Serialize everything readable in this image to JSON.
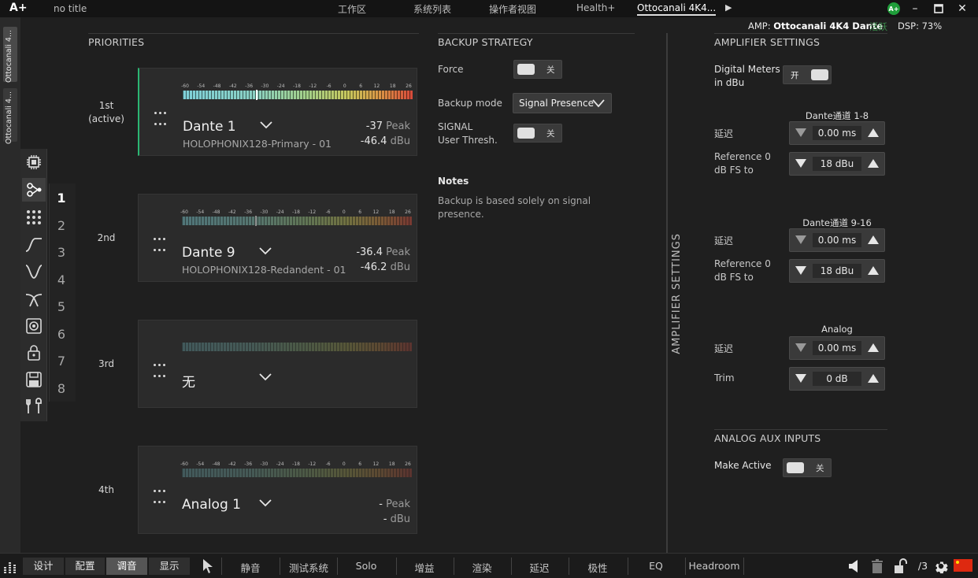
{
  "app": {
    "logo": "A+",
    "doc_title": "no title"
  },
  "top_tabs": [
    {
      "label": "工作区"
    },
    {
      "label": "系统列表"
    },
    {
      "label": "操作者视图"
    },
    {
      "label": "Health+"
    },
    {
      "label": "Ottocanali 4K4...",
      "active": true
    }
  ],
  "user_badge": "A+",
  "status": {
    "amp_prefix": "AMP:",
    "amp_name": "Ottocanali 4K4 Dante",
    "amp_state": "活跃",
    "dsp": "DSP:  73%"
  },
  "side_tabs": [
    "Ottocanali 4...",
    "Ottocanali 4..."
  ],
  "channel_numbers": [
    "1",
    "2",
    "3",
    "4",
    "5",
    "6",
    "7",
    "8"
  ],
  "tool_icons": [
    "processor-icon",
    "routing-icon",
    "matrix-icon",
    "lowpass-icon",
    "highpass-icon",
    "crossover-icon",
    "speaker-icon",
    "lock-icon",
    "save-icon",
    "tools-icon"
  ],
  "priorities": {
    "title": "PRIORITIES",
    "scale": [
      "-60",
      "-54",
      "-48",
      "-42",
      "-36",
      "-30",
      "-24",
      "-18",
      "-12",
      "-6",
      "0",
      "6",
      "12",
      "18",
      "26"
    ],
    "items": [
      {
        "rank": "1st",
        "rank_note": "(active)",
        "name": "Dante 1",
        "source": "HOLOPHONIX128-Primary - 01",
        "peak": "-37",
        "peak_unit": "Peak",
        "dbu": "-46.4",
        "dbu_unit": "dBu",
        "meter_level": 0.32,
        "active": true
      },
      {
        "rank": "2nd",
        "rank_note": "",
        "name": "Dante 9",
        "source": "HOLOPHONIX128-Redandent - 01",
        "peak": "-36.4",
        "peak_unit": "Peak",
        "dbu": "-46.2",
        "dbu_unit": "dBu",
        "meter_level": 0.32
      },
      {
        "rank": "3rd",
        "rank_note": "",
        "name": "无",
        "source": "",
        "peak": "",
        "peak_unit": "",
        "dbu": "",
        "dbu_unit": ""
      },
      {
        "rank": "4th",
        "rank_note": "",
        "name": "Analog 1",
        "source": "",
        "peak": "-",
        "peak_unit": "Peak",
        "dbu": "-",
        "dbu_unit": "dBu"
      }
    ]
  },
  "backup": {
    "title": "BACKUP STRATEGY",
    "force_label": "Force",
    "force_state": "关",
    "mode_label": "Backup mode",
    "mode_value": "Signal Presence",
    "signal_label_1": "SIGNAL",
    "signal_label_2": "User Thresh.",
    "signal_state": "关",
    "notes_title": "Notes",
    "notes_1": "Backup is based solely on signal",
    "notes_2": "presence."
  },
  "vertical_label": "AMPLIFIER SETTINGS",
  "amplifier": {
    "title": "AMPLIFIER SETTINGS",
    "meters_label_1": "Digital Meters",
    "meters_label_2": "in dBu",
    "meters_state": "开",
    "groups": [
      {
        "title": "Dante通道 1-8",
        "delay_label": "延迟",
        "delay": "0.00 ms",
        "ref_label_1": "Reference 0",
        "ref_label_2": "dB FS to",
        "ref": "18 dBu"
      },
      {
        "title": "Dante通道 9-16",
        "delay_label": "延迟",
        "delay": "0.00 ms",
        "ref_label_1": "Reference 0",
        "ref_label_2": "dB FS to",
        "ref": "18 dBu"
      },
      {
        "title": "Analog",
        "delay_label": "延迟",
        "delay": "0.00 ms",
        "trim_label": "Trim",
        "trim": "0 dB"
      }
    ],
    "aux_title": "ANALOG AUX INPUTS",
    "aux_label": "Make Active",
    "aux_state": "关"
  },
  "bottom": {
    "modes": [
      "设计",
      "配置",
      "调音",
      "显示"
    ],
    "active_mode": "调音",
    "filters": [
      "静音",
      "测试系统",
      "Solo",
      "增益",
      "渲染",
      "延迟",
      "极性",
      "EQ",
      "Headroom"
    ],
    "page": "/3"
  },
  "colors": {
    "active_accent": "#2bb673",
    "badge": "#1f9d3a"
  }
}
